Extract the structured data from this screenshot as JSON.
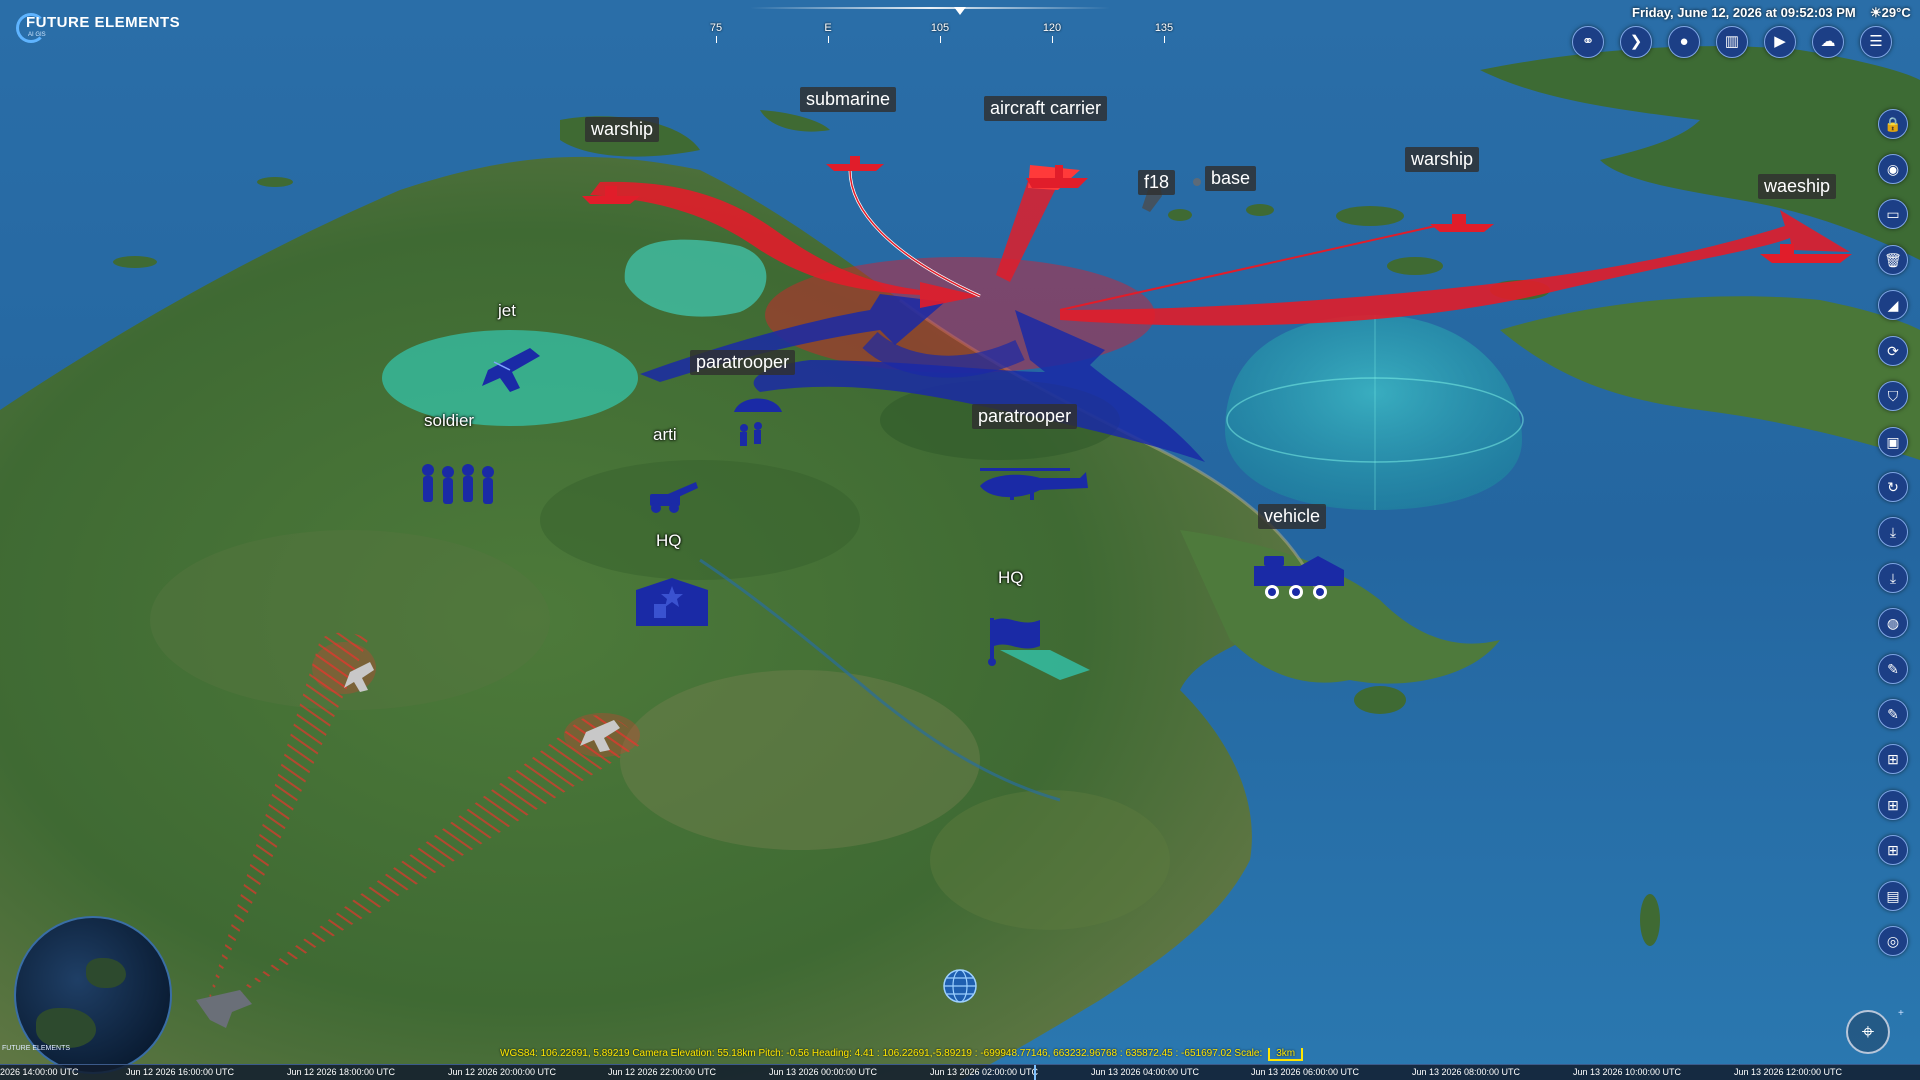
{
  "app": {
    "brand": "FUTURE ELEMENTS",
    "brand_sub": "AI GIS"
  },
  "datetime": {
    "text": "Friday, June 12, 2026 at 09:52:03 PM",
    "weather": "☀29°C"
  },
  "compass": {
    "ticks": [
      "75",
      "E",
      "105",
      "120",
      "135"
    ]
  },
  "toolbar_top": [
    {
      "name": "link-icon",
      "glyph": "⚭"
    },
    {
      "name": "play-forward-icon",
      "glyph": "❯"
    },
    {
      "name": "user-icon",
      "glyph": "●"
    },
    {
      "name": "buildings-icon",
      "glyph": "▥"
    },
    {
      "name": "play-icon",
      "glyph": "▶"
    },
    {
      "name": "cloud-icon",
      "glyph": "☁"
    },
    {
      "name": "menu-list-icon",
      "glyph": "☰"
    }
  ],
  "toolbar_right": [
    {
      "name": "lock-icon",
      "glyph": "🔒"
    },
    {
      "name": "eye-icon",
      "glyph": "◉"
    },
    {
      "name": "folder-icon",
      "glyph": "▭"
    },
    {
      "name": "trash-icon",
      "glyph": "🗑"
    },
    {
      "name": "satellite-icon",
      "glyph": "◢"
    },
    {
      "name": "rotate-icon",
      "glyph": "⟳"
    },
    {
      "name": "shield-icon",
      "glyph": "⛉"
    },
    {
      "name": "monitor-icon",
      "glyph": "▣"
    },
    {
      "name": "refresh-icon",
      "glyph": "↻"
    },
    {
      "name": "download-icon",
      "glyph": "⤓"
    },
    {
      "name": "download-alt-icon",
      "glyph": "⤓"
    },
    {
      "name": "profile-icon",
      "glyph": "◍"
    },
    {
      "name": "edit-icon",
      "glyph": "✎"
    },
    {
      "name": "edit-alt-icon",
      "glyph": "✎"
    },
    {
      "name": "add-layer-icon",
      "glyph": "⊞"
    },
    {
      "name": "add-marker-icon",
      "glyph": "⊞"
    },
    {
      "name": "add-shape-icon",
      "glyph": "⊞"
    },
    {
      "name": "city-icon",
      "glyph": "▤"
    },
    {
      "name": "target-icon",
      "glyph": "◎"
    }
  ],
  "map_labels": {
    "warship_left": "warship",
    "submarine": "submarine",
    "aircraft_carrier": "aircraft carrier",
    "f18": "f18",
    "base": "base",
    "warship_right": "warship",
    "waeship": "waeship",
    "jet": "jet",
    "soldier": "soldier",
    "paratrooper_left": "paratrooper",
    "arti": "arti",
    "paratrooper_right": "paratrooper",
    "vehicle": "vehicle",
    "hq_left": "HQ",
    "hq_right": "HQ"
  },
  "status": {
    "readout": "WGS84:  106.22691, 5.89219 Camera Elevation:  55.18km Pitch:  -0.56 Heading:  4.41 :  106.22691,-5.89219 :  -699948.77146, 663232.96768 :  635872.45 :  -651697.02 Scale:",
    "scale": "3km"
  },
  "timeline": {
    "labels": [
      "2026 14:00:00 UTC",
      "Jun 12 2026 16:00:00 UTC",
      "Jun 12 2026 18:00:00 UTC",
      "Jun 12 2026 20:00:00 UTC",
      "Jun 12 2026 22:00:00 UTC",
      "Jun 13 2026 00:00:00 UTC",
      "Jun 13 2026 02:00:00 UTC",
      "Jun 13 2026 04:00:00 UTC",
      "Jun 13 2026 06:00:00 UTC",
      "Jun 13 2026 08:00:00 UTC",
      "Jun 13 2026 10:00:00 UTC",
      "Jun 13 2026 12:00:00 UTC"
    ]
  },
  "minimap_caption": "FUTURE ELEMENTS",
  "colors": {
    "hostile": "#e11d2a",
    "friendly": "#1a2aa6",
    "coverage": "#2fe0d2",
    "ui_button": "#1c3f86",
    "status_text": "#ffe600"
  }
}
